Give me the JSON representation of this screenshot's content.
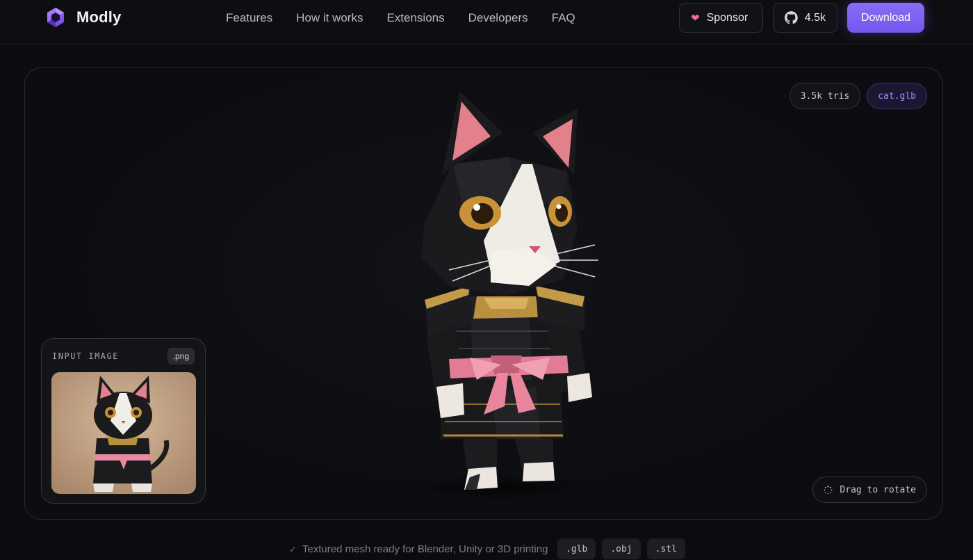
{
  "brand": {
    "name": "Modly",
    "logo_icon": "hexagon-logo-icon",
    "accent": "#8a6cf7"
  },
  "nav": {
    "items": [
      "Features",
      "How it works",
      "Extensions",
      "Developers",
      "FAQ"
    ]
  },
  "actions": {
    "sponsor": {
      "label": "Sponsor",
      "icon": "heart-icon",
      "icon_color": "#f06aa7"
    },
    "github": {
      "label": "4.5k",
      "icon": "github-icon"
    },
    "download": {
      "label": "Download",
      "color": "#7c5cf2"
    }
  },
  "viewer": {
    "tris_badge": "3.5k tris",
    "file_badge": "cat.glb",
    "rotate_hint": "Drag to rotate",
    "model_description_icon": "samurai-cat-3d-model"
  },
  "input_card": {
    "label": "INPUT IMAGE",
    "ext": ".png",
    "image_icon": "samurai-cat-photo"
  },
  "footer": {
    "ready_text": "Textured mesh ready for Blender, Unity or 3D printing",
    "formats": [
      ".glb",
      ".obj",
      ".stl"
    ]
  }
}
